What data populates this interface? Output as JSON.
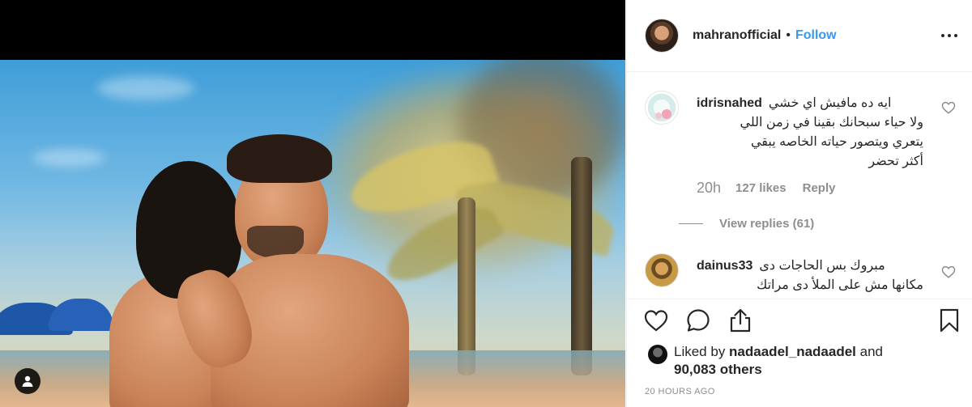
{
  "post": {
    "author": "mahranofficial",
    "dot": "•",
    "follow_label": "Follow",
    "more_options_icon": "more-options-icon",
    "tag_icon": "user-tag-icon"
  },
  "comments": [
    {
      "username": "idrisnahed",
      "text_lines": [
        "ايه ده مافيش اي خشي",
        "ولا حياء سبحانك بقينا في زمن اللي",
        "يتعري ويتصور حياته الخاصه يبقي",
        "أكثر تحضر"
      ],
      "time": "20h",
      "likes": "127 likes",
      "reply_label": "Reply",
      "view_replies": "View replies (61)"
    },
    {
      "username": "dainus33",
      "text_lines": [
        "مبروك بس الحاجات دى",
        "مكانها مش على الملأ دى مراتك"
      ]
    }
  ],
  "actions": {
    "like_icon": "heart-icon",
    "comment_icon": "comment-icon",
    "share_icon": "share-icon",
    "save_icon": "bookmark-icon"
  },
  "likes": {
    "prefix": "Liked by ",
    "liker": "nadaadel_nadaadel",
    "middle": " and",
    "count": "90,083 others"
  },
  "timestamp": "20 HOURS AGO",
  "colors": {
    "link_blue": "#3897f0",
    "text_dark": "#262626",
    "text_muted": "#8e8e8e",
    "border": "#efefef"
  }
}
